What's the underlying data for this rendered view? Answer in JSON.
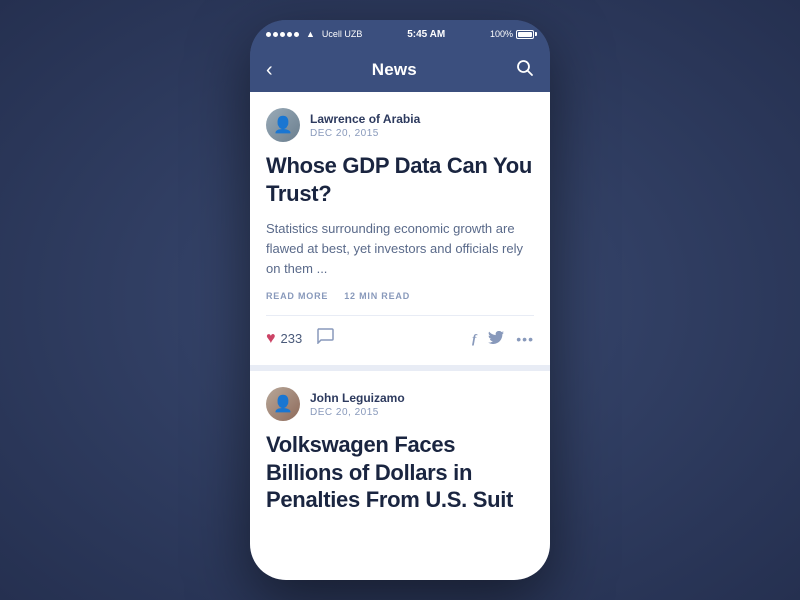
{
  "statusBar": {
    "carrier": "Ucell UZB",
    "time": "5:45 AM",
    "battery": "100%"
  },
  "navBar": {
    "title": "News",
    "backLabel": "‹",
    "searchLabel": "⌕"
  },
  "articles": [
    {
      "id": "article-1",
      "authorName": "Lawrence of Arabia",
      "date": "DEC 20, 2015",
      "title": "Whose GDP Data Can You Trust?",
      "excerpt": "Statistics surrounding economic growth are flawed at best, yet investors and officials rely on them ...",
      "readMoreLabel": "READ MORE",
      "readTimeLabel": "12 MIN READ",
      "likeCount": "233"
    },
    {
      "id": "article-2",
      "authorName": "John Leguizamo",
      "date": "DEC 20, 2015",
      "title": "Volkswagen Faces Billions of Dollars in Penalties From U.S. Suit",
      "excerpt": ""
    }
  ]
}
